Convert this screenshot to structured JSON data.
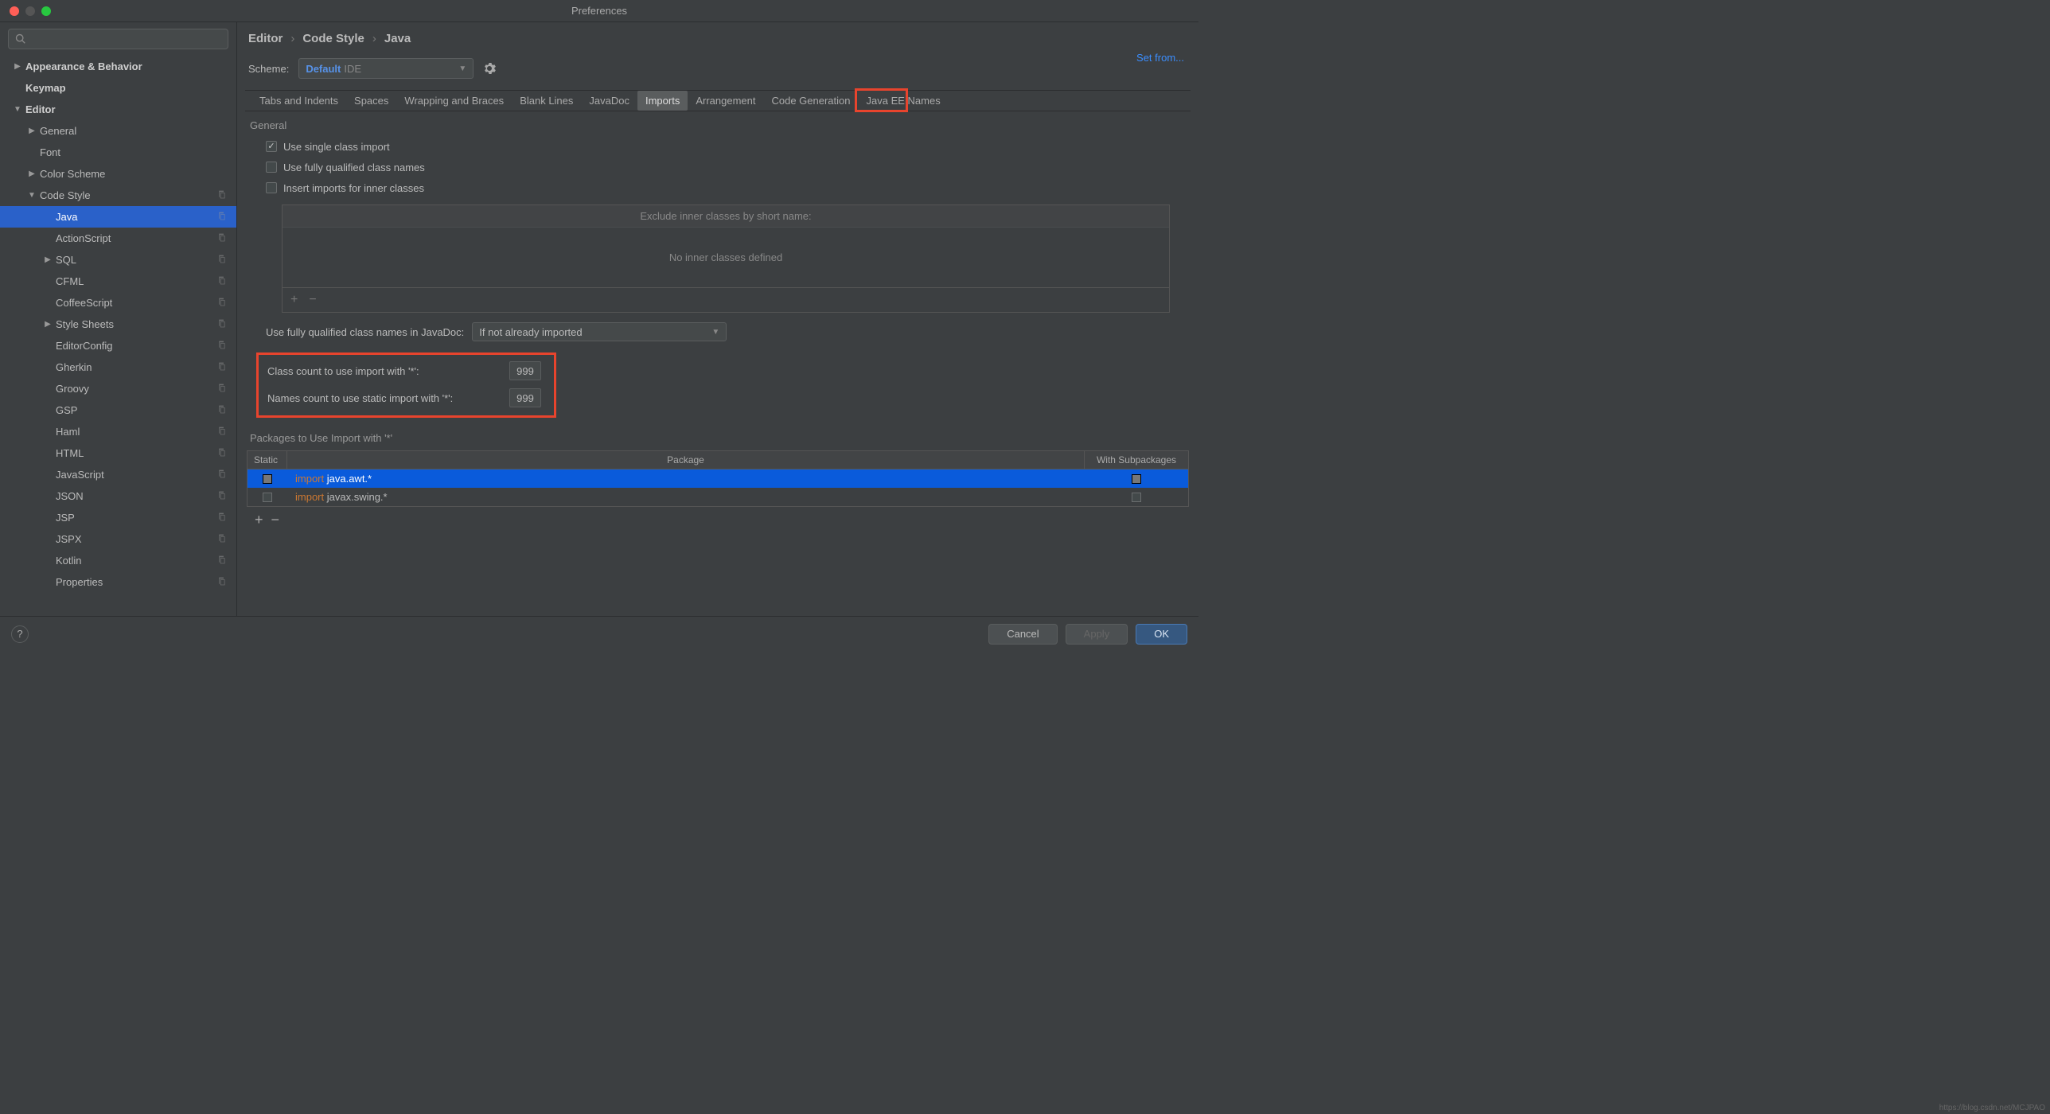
{
  "window": {
    "title": "Preferences"
  },
  "search": {
    "placeholder": ""
  },
  "sidebar": {
    "items": [
      {
        "label": "Appearance & Behavior",
        "level": 0,
        "arrow": "▶",
        "bold": true
      },
      {
        "label": "Keymap",
        "level": 0,
        "arrow": "",
        "bold": true
      },
      {
        "label": "Editor",
        "level": 0,
        "arrow": "▼",
        "bold": true
      },
      {
        "label": "General",
        "level": 1,
        "arrow": "▶"
      },
      {
        "label": "Font",
        "level": 1,
        "arrow": ""
      },
      {
        "label": "Color Scheme",
        "level": 1,
        "arrow": "▶"
      },
      {
        "label": "Code Style",
        "level": 1,
        "arrow": "▼",
        "copy": true
      },
      {
        "label": "Java",
        "level": 2,
        "arrow": "",
        "selected": true,
        "copy": true
      },
      {
        "label": "ActionScript",
        "level": 2,
        "arrow": "",
        "copy": true
      },
      {
        "label": "SQL",
        "level": 2,
        "arrow": "▶",
        "copy": true
      },
      {
        "label": "CFML",
        "level": 2,
        "arrow": "",
        "copy": true
      },
      {
        "label": "CoffeeScript",
        "level": 2,
        "arrow": "",
        "copy": true
      },
      {
        "label": "Style Sheets",
        "level": 2,
        "arrow": "▶",
        "copy": true
      },
      {
        "label": "EditorConfig",
        "level": 2,
        "arrow": "",
        "copy": true
      },
      {
        "label": "Gherkin",
        "level": 2,
        "arrow": "",
        "copy": true
      },
      {
        "label": "Groovy",
        "level": 2,
        "arrow": "",
        "copy": true
      },
      {
        "label": "GSP",
        "level": 2,
        "arrow": "",
        "copy": true
      },
      {
        "label": "Haml",
        "level": 2,
        "arrow": "",
        "copy": true
      },
      {
        "label": "HTML",
        "level": 2,
        "arrow": "",
        "copy": true
      },
      {
        "label": "JavaScript",
        "level": 2,
        "arrow": "",
        "copy": true
      },
      {
        "label": "JSON",
        "level": 2,
        "arrow": "",
        "copy": true
      },
      {
        "label": "JSP",
        "level": 2,
        "arrow": "",
        "copy": true
      },
      {
        "label": "JSPX",
        "level": 2,
        "arrow": "",
        "copy": true
      },
      {
        "label": "Kotlin",
        "level": 2,
        "arrow": "",
        "copy": true
      },
      {
        "label": "Properties",
        "level": 2,
        "arrow": "",
        "copy": true
      }
    ]
  },
  "breadcrumb": {
    "a": "Editor",
    "b": "Code Style",
    "c": "Java",
    "sep": "›"
  },
  "scheme": {
    "label": "Scheme:",
    "value": "Default",
    "suffix": "IDE"
  },
  "set_from": "Set from...",
  "tabs": [
    "Tabs and Indents",
    "Spaces",
    "Wrapping and Braces",
    "Blank Lines",
    "JavaDoc",
    "Imports",
    "Arrangement",
    "Code Generation",
    "Java EE Names"
  ],
  "active_tab": "Imports",
  "general": {
    "title": "General",
    "use_single": "Use single class import",
    "use_fqcn": "Use fully qualified class names",
    "insert_inner": "Insert imports for inner classes",
    "exclude_title": "Exclude inner classes by short name:",
    "exclude_empty": "No inner classes defined"
  },
  "javadoc_fqcn": {
    "label": "Use fully qualified class names in JavaDoc:",
    "value": "If not already imported"
  },
  "counts": {
    "class_label": "Class count to use import with '*':",
    "class_value": "999",
    "names_label": "Names count to use static import with '*':",
    "names_value": "999"
  },
  "packages": {
    "title": "Packages to Use Import with '*'",
    "col_static": "Static",
    "col_pkg": "Package",
    "col_sub": "With Subpackages",
    "rows": [
      {
        "kw": "import",
        "text": " java.awt.*",
        "selected": true
      },
      {
        "kw": "import",
        "text": " javax.swing.*",
        "selected": false
      }
    ]
  },
  "footer": {
    "cancel": "Cancel",
    "apply": "Apply",
    "ok": "OK"
  },
  "watermark": "https://blog.csdn.net/MCJPAO"
}
